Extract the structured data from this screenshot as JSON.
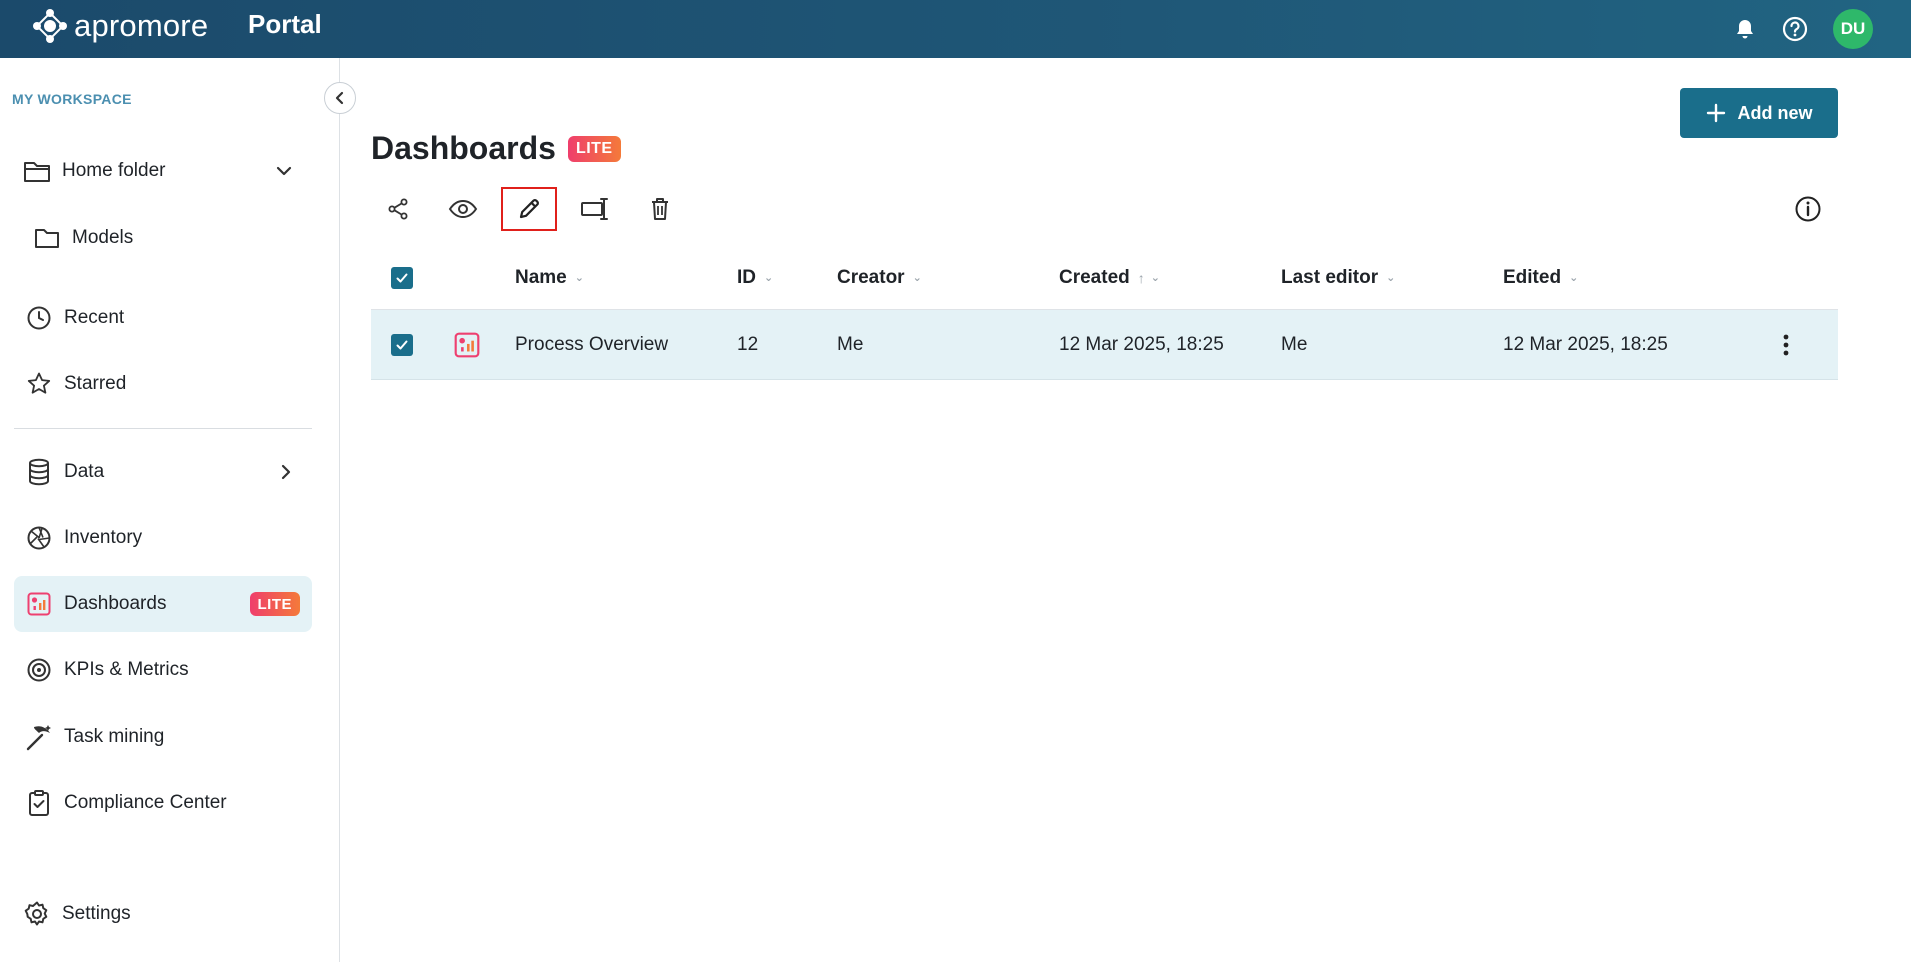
{
  "header": {
    "brand": "apromore",
    "section": "Portal",
    "avatar_initials": "DU",
    "icons": [
      "bell-icon",
      "help-icon"
    ]
  },
  "sidebar": {
    "workspace_label": "MY WORKSPACE",
    "items": [
      {
        "label": "Home folder",
        "icon": "folder-icon"
      },
      {
        "label": "Models",
        "icon": "folder-icon"
      },
      {
        "label": "Recent",
        "icon": "clock-icon"
      },
      {
        "label": "Starred",
        "icon": "star-icon"
      },
      {
        "label": "Data",
        "icon": "database-icon"
      },
      {
        "label": "Inventory",
        "icon": "aperture-icon"
      },
      {
        "label": "Dashboards",
        "icon": "dashboard-icon",
        "badge": "LITE"
      },
      {
        "label": "KPIs & Metrics",
        "icon": "target-icon"
      },
      {
        "label": "Task mining",
        "icon": "pickaxe-icon"
      },
      {
        "label": "Compliance Center",
        "icon": "clipboard-check-icon"
      },
      {
        "label": "Settings",
        "icon": "gear-icon"
      }
    ]
  },
  "main": {
    "add_button": "Add new",
    "title": "Dashboards",
    "title_badge": "LITE",
    "toolbar": [
      "share-icon",
      "eye-icon",
      "pencil-icon",
      "rename-icon",
      "trash-icon"
    ],
    "columns": [
      "Name",
      "ID",
      "Creator",
      "Created",
      "Last editor",
      "Edited"
    ],
    "rows": [
      {
        "name": "Process Overview",
        "id": "12",
        "creator": "Me",
        "created": "12 Mar 2025, 18:25",
        "last_editor": "Me",
        "edited": "12 Mar 2025, 18:25"
      }
    ]
  },
  "colors": {
    "topbar": "#1b4a6b",
    "accent": "#1a6e8b",
    "active_row": "#e4f2f6",
    "lite_badge_start": "#ef3e6c",
    "lite_badge_end": "#f47a3a",
    "avatar": "#2eb86a"
  }
}
